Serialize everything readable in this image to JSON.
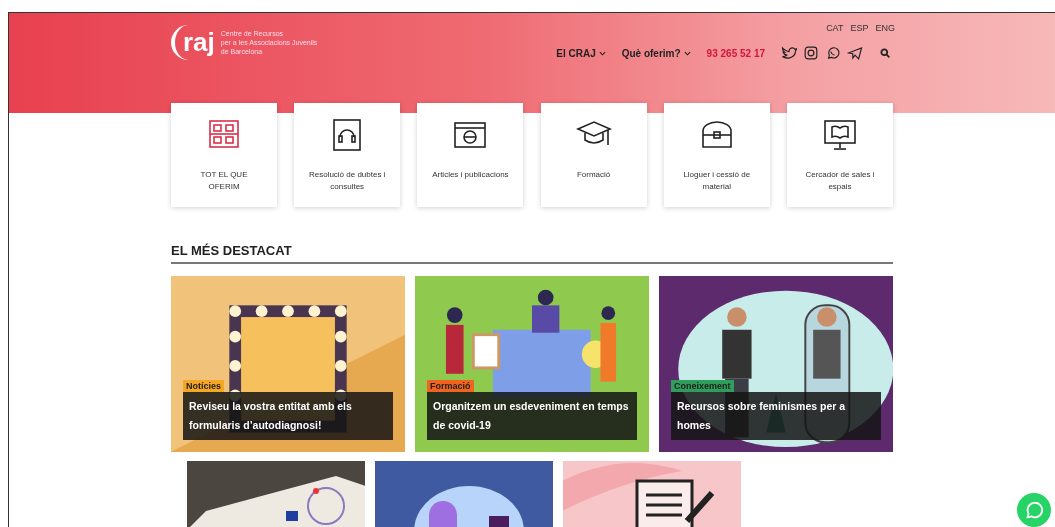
{
  "header": {
    "logo": {
      "mark": "raj",
      "lines": [
        "Centre de Recursos",
        "per a les Associacions Juvenils",
        "de Barcelona"
      ]
    },
    "languages": [
      "CAT",
      "ESP",
      "ENG"
    ],
    "nav": [
      {
        "label": "El CRAJ",
        "kind": "menu"
      },
      {
        "label": "Què oferim?",
        "kind": "menu"
      },
      {
        "label": "93 265 52 17",
        "kind": "phone"
      }
    ]
  },
  "services": [
    {
      "label": "TOT EL QUE OFERIM",
      "highlight": true
    },
    {
      "label": "Resolució de dubtes i consultes",
      "highlight": false
    },
    {
      "label": "Articles i publicacions",
      "highlight": false
    },
    {
      "label": "Formació",
      "highlight": false
    },
    {
      "label": "Lloguer i cessió de material",
      "highlight": false
    },
    {
      "label": "Cercador de sales i espais",
      "highlight": false
    }
  ],
  "featured": {
    "title": "EL MÉS DESTACAT",
    "items": [
      {
        "tag": "Notícies",
        "color": "#f5a623",
        "title": "Reviseu la vostra entitat amb els formularis d’autodiagnosi!"
      },
      {
        "tag": "Formació",
        "color": "#f0641e",
        "title": "Organitzem un esdeveniment en temps de covid-19"
      },
      {
        "tag": "Coneixement",
        "color": "#2e9e5a",
        "title": "Recursos sobre feminismes per a homes"
      }
    ]
  }
}
